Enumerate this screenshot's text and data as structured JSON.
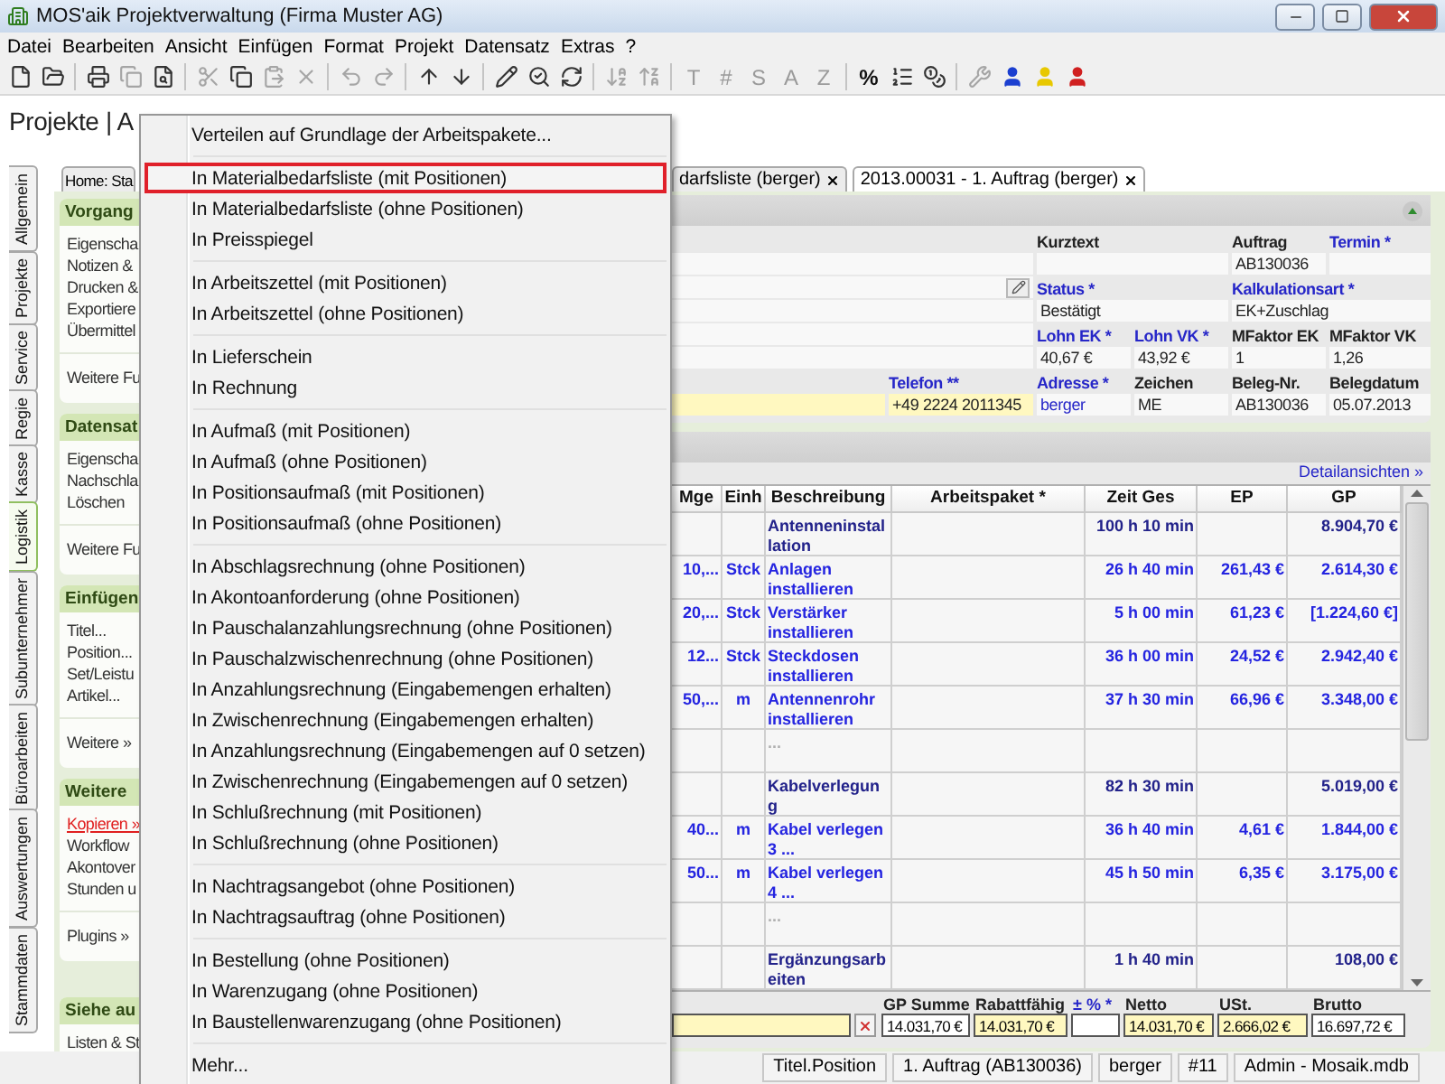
{
  "window": {
    "title": "MOS'aik Projektverwaltung (Firma Muster AG)"
  },
  "menubar": [
    "Datei",
    "Bearbeiten",
    "Ansicht",
    "Einfügen",
    "Format",
    "Projekt",
    "Datensatz",
    "Extras",
    "?"
  ],
  "toolbar": {
    "letter_buttons": [
      {
        "label": "T",
        "disabled": true
      },
      {
        "label": "#",
        "disabled": true
      },
      {
        "label": "S",
        "disabled": true
      },
      {
        "label": "A",
        "disabled": true
      },
      {
        "label": "Z",
        "disabled": true
      }
    ],
    "percent_button": "%"
  },
  "page_title": "Projekte | A",
  "vtabs": [
    {
      "label": "Allgemein",
      "selected": false
    },
    {
      "label": "Projekte",
      "selected": false
    },
    {
      "label": "Service",
      "selected": false
    },
    {
      "label": "Regie",
      "selected": false
    },
    {
      "label": "Kasse",
      "selected": false
    },
    {
      "label": "Logistik",
      "selected": true
    },
    {
      "label": "Subunternehmer",
      "selected": false
    },
    {
      "label": "Büroarbeiten",
      "selected": false
    },
    {
      "label": "Auswertungen",
      "selected": false
    },
    {
      "label": "Stammdaten",
      "selected": false
    }
  ],
  "doc_tabs": [
    {
      "label": "Home: Sta",
      "selected": false,
      "closable": false
    },
    {
      "label": "darfsliste (berger)",
      "selected": false,
      "closable": true
    },
    {
      "label": "2013.00031 - 1. Auftrag (berger)",
      "selected": true,
      "closable": true
    }
  ],
  "task_panel": [
    {
      "header": "Vorgang",
      "items": [
        {
          "label": "Eigenscha",
          "hovered": false
        },
        {
          "label": "Notizen &",
          "hovered": false
        },
        {
          "label": "Drucken &",
          "hovered": false
        },
        {
          "label": "Exportiere",
          "hovered": false
        },
        {
          "label": "Übermittel",
          "hovered": false
        }
      ],
      "footer": "Weitere Fu"
    },
    {
      "header": "Datensat",
      "items": [
        {
          "label": "Eigenscha",
          "hovered": false
        },
        {
          "label": "Nachschla",
          "hovered": false
        },
        {
          "label": "Löschen",
          "hovered": false
        }
      ],
      "footer": "Weitere Fu"
    },
    {
      "header": "Einfügen",
      "items": [
        {
          "label": "Titel...",
          "hovered": false
        },
        {
          "label": "Position...",
          "hovered": false
        },
        {
          "label": "Set/Leistu",
          "hovered": false
        },
        {
          "label": "Artikel...",
          "hovered": false
        }
      ],
      "footer": "Weitere »"
    },
    {
      "header": "Weitere",
      "items": [
        {
          "label": "Kopieren »",
          "hovered": true
        },
        {
          "label": "Workflow",
          "hovered": false
        },
        {
          "label": "Akontover",
          "hovered": false
        },
        {
          "label": "Stunden u",
          "hovered": false
        }
      ],
      "footer": "Plugins »"
    },
    {
      "header": "Siehe au",
      "items": [
        {
          "label": "Listen & St",
          "hovered": false
        }
      ]
    }
  ],
  "form": {
    "left_fields": [
      {
        "kind": "plain"
      },
      {
        "kind": "lookup"
      },
      {
        "kind": "plain"
      },
      {
        "kind": "plain"
      },
      {
        "kind": "plain"
      },
      {
        "kind": "highlighted"
      }
    ],
    "fields": [
      {
        "label": "Kurztext",
        "linked": false,
        "highlighted": false
      },
      {
        "label": "Auftrag",
        "value": "AB130036",
        "linked": false,
        "value_link": false,
        "highlighted": false
      },
      {
        "label": "Termin *",
        "linked": true,
        "highlighted": false
      },
      {
        "label": "Status *",
        "value": "Bestätigt",
        "linked": true,
        "value_link": false,
        "highlighted": false
      },
      {
        "label": "Kalkulationsart *",
        "value": "EK+Zuschlag",
        "linked": true,
        "value_link": false,
        "highlighted": false
      },
      {
        "label": "Lohn EK *",
        "value": "40,67 €",
        "linked": true,
        "value_link": false,
        "highlighted": false
      },
      {
        "label": "Lohn VK *",
        "value": "43,92 €",
        "linked": true,
        "value_link": false,
        "highlighted": false
      },
      {
        "label": "MFaktor EK",
        "value": "1",
        "linked": false,
        "value_link": false,
        "highlighted": false
      },
      {
        "label": "MFaktor VK",
        "value": "1,26",
        "linked": false,
        "value_link": false,
        "highlighted": false
      },
      {
        "label": "Telefon **",
        "value": "+49 2224 2011345",
        "linked": true,
        "value_link": false,
        "highlighted": true
      },
      {
        "label": "Adresse *",
        "value": "berger",
        "linked": true,
        "value_link": true,
        "highlighted": false
      },
      {
        "label": "Zeichen",
        "value": "ME",
        "linked": false,
        "value_link": false,
        "highlighted": false
      },
      {
        "label": "Beleg-Nr.",
        "value": "AB130036",
        "linked": false,
        "value_link": false,
        "highlighted": false
      },
      {
        "label": "Belegdatum",
        "value": "05.07.2013",
        "linked": false,
        "value_link": false,
        "highlighted": false
      }
    ]
  },
  "detail_link": "Detailansichten »",
  "table": {
    "columns": [
      "Mge",
      "Einh",
      "Beschreibung",
      "Arbeitspaket *",
      "Zeit Ges",
      "EP",
      "GP"
    ],
    "rows": [
      {
        "kind": "title",
        "desc": "Antenneninstallation",
        "zeit": "100 h 10 min",
        "gp": "8.904,70 €"
      },
      {
        "kind": "position",
        "mge": "10,...",
        "einh": "Stck",
        "desc": "Anlagen installieren",
        "zeit": "26 h 40 min",
        "ep": "261,43 €",
        "gp": "2.614,30 €"
      },
      {
        "kind": "position",
        "mge": "20,...",
        "einh": "Stck",
        "desc": "Verstärker installieren",
        "zeit": "5 h 00 min",
        "ep": "61,23 €",
        "gp": "[1.224,60 €]"
      },
      {
        "kind": "position",
        "mge": "12...",
        "einh": "Stck",
        "desc": "Steckdosen installieren",
        "zeit": "36 h 00 min",
        "ep": "24,52 €",
        "gp": "2.942,40 €"
      },
      {
        "kind": "position",
        "mge": "50,...",
        "einh": "m",
        "desc": "Antennenrohr installieren",
        "zeit": "37 h 30 min",
        "ep": "66,96 €",
        "gp": "3.348,00 €"
      },
      {
        "kind": "empty",
        "desc": "..."
      },
      {
        "kind": "title",
        "desc": "Kabelverlegung",
        "zeit": "82 h 30 min",
        "gp": "5.019,00 €"
      },
      {
        "kind": "position",
        "mge": "40...",
        "einh": "m",
        "desc": "Kabel verlegen 3 ...",
        "zeit": "36 h 40 min",
        "ep": "4,61 €",
        "gp": "1.844,00 €"
      },
      {
        "kind": "position",
        "mge": "50...",
        "einh": "m",
        "desc": "Kabel verlegen 4 ...",
        "zeit": "45 h 50 min",
        "ep": "6,35 €",
        "gp": "3.175,00 €"
      },
      {
        "kind": "empty",
        "desc": "..."
      },
      {
        "kind": "title",
        "desc": "Ergänzungsarbeiten",
        "zeit": "1 h 40 min",
        "gp": "108,00 €"
      }
    ]
  },
  "totals": {
    "note_field": {
      "kind": "highlighted",
      "clearable": true
    },
    "items": [
      {
        "label": "GP Summe",
        "value": "14.031,70 €",
        "linked": false,
        "highlighted": false
      },
      {
        "label": "Rabattfähig",
        "value": "14.031,70 €",
        "linked": false,
        "highlighted": true
      },
      {
        "label": "± % *",
        "linked": true,
        "highlighted": false
      },
      {
        "label": "Netto",
        "value": "14.031,70 €",
        "linked": false,
        "highlighted": true
      },
      {
        "label": "USt.",
        "value": "2.666,02 €",
        "linked": false,
        "highlighted": true
      },
      {
        "label": "Brutto",
        "value": "16.697,72 €",
        "linked": false,
        "highlighted": false
      }
    ]
  },
  "context_menu": [
    [
      {
        "label": "Verteilen auf Grundlage der Arbeitspakete...",
        "selected": false
      }
    ],
    [
      {
        "label": "In Materialbedarfsliste (mit Positionen)",
        "selected": true
      },
      {
        "label": "In Materialbedarfsliste (ohne Positionen)",
        "selected": false
      },
      {
        "label": "In Preisspiegel",
        "selected": false
      }
    ],
    [
      {
        "label": "In Arbeitszettel (mit Positionen)",
        "selected": false
      },
      {
        "label": "In Arbeitszettel (ohne Positionen)",
        "selected": false
      }
    ],
    [
      {
        "label": "In Lieferschein",
        "selected": false
      },
      {
        "label": "In Rechnung",
        "selected": false
      }
    ],
    [
      {
        "label": "In Aufmaß (mit Positionen)",
        "selected": false
      },
      {
        "label": "In Aufmaß (ohne Positionen)",
        "selected": false
      },
      {
        "label": "In Positionsaufmaß (mit Positionen)",
        "selected": false
      },
      {
        "label": "In Positionsaufmaß (ohne Positionen)",
        "selected": false
      }
    ],
    [
      {
        "label": "In Abschlagsrechnung (ohne Positionen)",
        "selected": false
      },
      {
        "label": "In Akontoanforderung (ohne Positionen)",
        "selected": false
      },
      {
        "label": "In Pauschalanzahlungsrechnung (ohne Positionen)",
        "selected": false
      },
      {
        "label": "In Pauschalzwischenrechnung (ohne Positionen)",
        "selected": false
      },
      {
        "label": "In Anzahlungsrechnung (Eingabemengen erhalten)",
        "selected": false
      },
      {
        "label": "In Zwischenrechnung (Eingabemengen erhalten)",
        "selected": false
      },
      {
        "label": "In Anzahlungsrechnung (Eingabemengen auf 0 setzen)",
        "selected": false
      },
      {
        "label": "In Zwischenrechnung (Eingabemengen auf 0 setzen)",
        "selected": false
      },
      {
        "label": "In Schlußrechnung (mit Positionen)",
        "selected": false
      },
      {
        "label": "In Schlußrechnung (ohne Positionen)",
        "selected": false
      }
    ],
    [
      {
        "label": "In Nachtragsangebot (ohne Positionen)",
        "selected": false
      },
      {
        "label": "In Nachtragsauftrag (ohne Positionen)",
        "selected": false
      }
    ],
    [
      {
        "label": "In Bestellung (ohne Positionen)",
        "selected": false
      },
      {
        "label": "In Warenzugang (ohne Positionen)",
        "selected": false
      },
      {
        "label": "In Baustellenwarenzugang (ohne Positionen)",
        "selected": false
      }
    ],
    [
      {
        "label": "Mehr...",
        "selected": false
      }
    ]
  ],
  "status_bar": [
    "Titel.Position",
    "1. Auftrag (AB130036)",
    "berger",
    "#11",
    "Admin - Mosaik.mdb"
  ]
}
